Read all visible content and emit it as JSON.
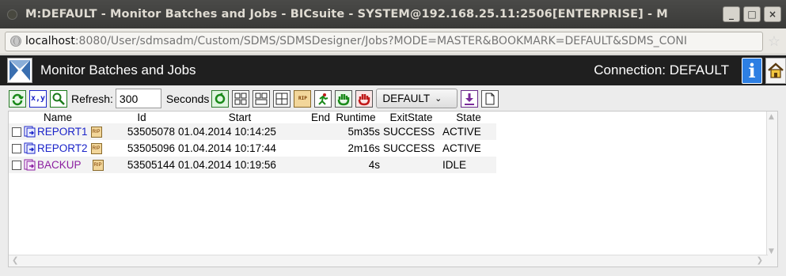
{
  "window": {
    "title": "M:DEFAULT - Monitor Batches and Jobs - BICsuite - SYSTEM@192.168.25.11:2506[ENTERPRISE] - M",
    "controls": [
      "_",
      "□",
      "×"
    ]
  },
  "address": {
    "host": "localhost",
    "rest": ":8080/User/sdmsadm/Custom/SDMS/SDMSDesigner/Jobs?MODE=MASTER&BOOKMARK=DEFAULT&SDMS_CONI",
    "star_glyph": "☆"
  },
  "app": {
    "title": "Monitor Batches and Jobs",
    "connection": "Connection: DEFAULT",
    "info_glyph": "i"
  },
  "toolbar": {
    "refresh_label": "Refresh:",
    "refresh_value": "300",
    "seconds_label": "Seconds",
    "bookmark": "DEFAULT",
    "xy_label": "x,y"
  },
  "table": {
    "headers": [
      "Name",
      "Id",
      "Start",
      "End",
      "Runtime",
      "ExitState",
      "State"
    ],
    "rows": [
      {
        "name": "REPORT1",
        "badge": "RIP",
        "id": "53505078",
        "start": "01.04.2014 10:14:25",
        "end": "",
        "runtime": "5m35s",
        "exit": "SUCCESS",
        "state": "ACTIVE",
        "style": "active"
      },
      {
        "name": "REPORT2",
        "badge": "RIP",
        "id": "53505096",
        "start": "01.04.2014 10:17:44",
        "end": "",
        "runtime": "2m16s",
        "exit": "SUCCESS",
        "state": "ACTIVE",
        "style": "active"
      },
      {
        "name": "BACKUP",
        "badge": "RIP",
        "id": "53505144",
        "start": "01.04.2014 10:19:56",
        "end": "",
        "runtime": "4s",
        "exit": "",
        "state": "IDLE",
        "style": "idle"
      }
    ]
  },
  "colors": {
    "link_active": "#1a23c9",
    "link_idle": "#8b1ea0",
    "header_bg": "#1f1f1f",
    "titlebar_bg": "#3f3f3d"
  }
}
